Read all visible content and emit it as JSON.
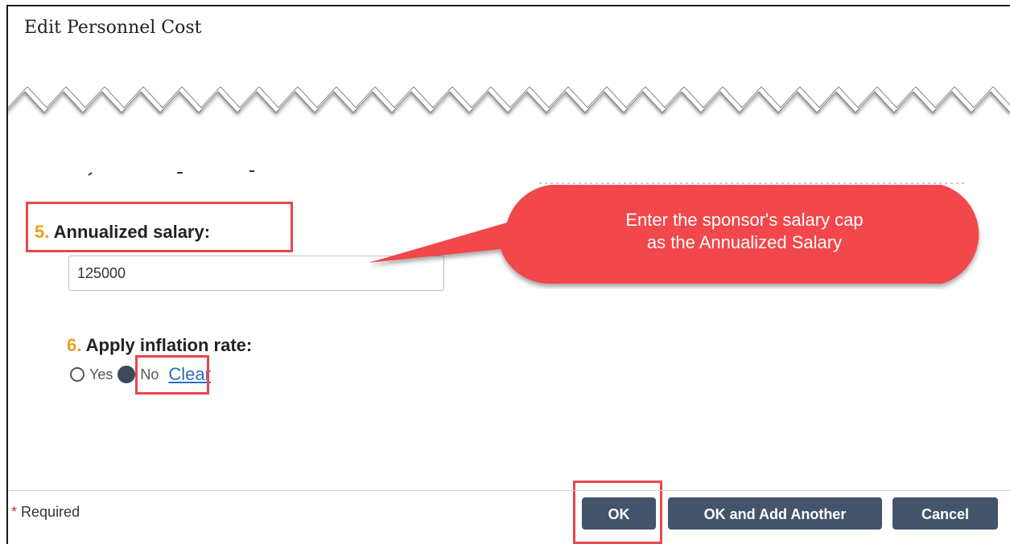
{
  "dialog": {
    "title": "Edit Personnel Cost"
  },
  "fields": {
    "annualized_salary": {
      "number": "5.",
      "label": "Annualized salary:",
      "value": "125000"
    },
    "inflation": {
      "number": "6.",
      "label": "Apply inflation rate:",
      "options": [
        "Yes",
        "No"
      ],
      "selected": "No",
      "clear_label": "Clear"
    }
  },
  "callout": {
    "line1": "Enter the sponsor's salary cap",
    "line2": "as the Annualized Salary",
    "color": "#f2474b"
  },
  "footer": {
    "required_star": "*",
    "required_label": "Required",
    "ok_label": "OK",
    "ok_add_label": "OK and Add Another",
    "cancel_label": "Cancel"
  },
  "colors": {
    "highlight": "#e8474b",
    "number_accent": "#e6a01e",
    "button_bg": "#44546a",
    "link": "#2a6ebb"
  }
}
